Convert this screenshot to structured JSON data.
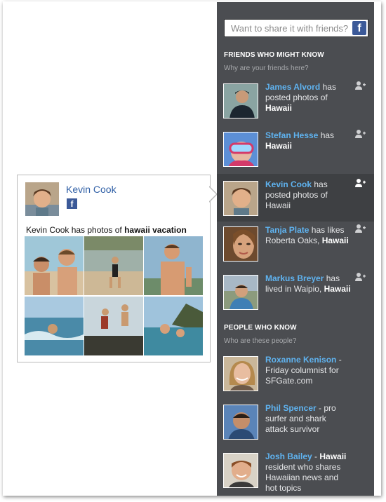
{
  "search": {
    "placeholder": "Want to share it with friends?",
    "fb_glyph": "f"
  },
  "friends_section": {
    "title": "FRIENDS WHO MIGHT KNOW",
    "subtitle": "Why are your friends here?",
    "items": [
      {
        "name": "James Alvord",
        "mid": " has posted photos of ",
        "place": "Hawaii",
        "tail": ""
      },
      {
        "name": "Stefan Hesse",
        "mid": " has ",
        "place": "Hawaii",
        "tail": ""
      },
      {
        "name": "Kevin Cook",
        "mid": " has posted photos of Hawaii",
        "place": "",
        "tail": ""
      },
      {
        "name": "Tanja Plate",
        "mid": " has likes Roberta Oaks, ",
        "place": "Hawaii",
        "tail": ""
      },
      {
        "name": "Markus Breyer",
        "mid": " has lived in Waipio, ",
        "place": "Hawaii",
        "tail": ""
      }
    ]
  },
  "people_section": {
    "title": "PEOPLE WHO KNOW",
    "subtitle": "Who are these people?",
    "items": [
      {
        "name": "Roxanne Kenison",
        "mid": " - Friday columnist for SFGate.com",
        "place": "",
        "tail": ""
      },
      {
        "name": "Phil Spencer",
        "mid": " - pro surfer and shark attack survivor",
        "place": "",
        "tail": ""
      },
      {
        "name": "Josh Bailey",
        "mid": " - ",
        "place": "Hawaii",
        "tail": " resident who shares Hawaiian news and hot topics"
      }
    ]
  },
  "card": {
    "name": "Kevin Cook",
    "fb_glyph": "f",
    "text_prefix": "Kevin Cook has photos of ",
    "text_bold": "hawaii vacation"
  },
  "colors": {
    "sidebar": "#4b4d51",
    "link": "#5fb3f0",
    "card_name": "#2f5fa6",
    "facebook": "#3b5998"
  },
  "icons": [
    "facebook-icon",
    "add-friend-icon"
  ]
}
